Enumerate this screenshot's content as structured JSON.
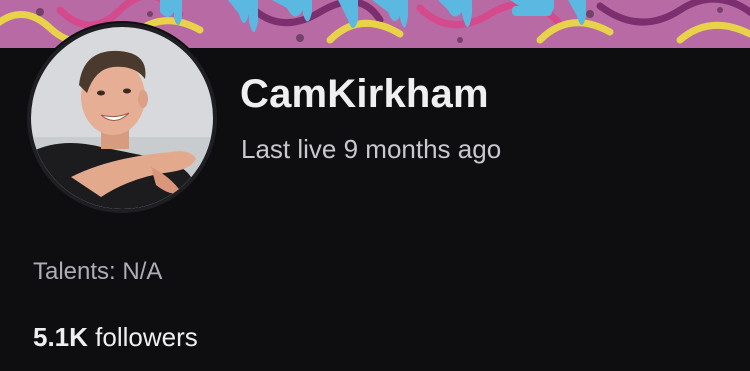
{
  "channel": {
    "name": "CamKirkham",
    "last_live": "Last live 9 months ago",
    "talents": "Talents: N/A",
    "followers_count": "5.1K",
    "followers_label": "followers"
  },
  "colors": {
    "background": "#0e0e10",
    "name_text": "#efeff1",
    "secondary_text": "#adadb8",
    "banner_pink": "#b86aa4",
    "banner_yellow": "#e8d24a",
    "banner_drip_blue": "#5bb8e0"
  }
}
